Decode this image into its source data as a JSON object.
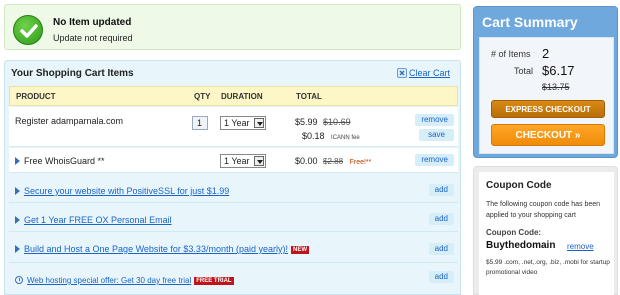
{
  "notice": {
    "title": "No Item updated",
    "subtitle": "Update not required"
  },
  "cart": {
    "heading": "Your Shopping Cart Items",
    "clear_label": "Clear Cart",
    "columns": {
      "product": "PRODUCT",
      "qty": "QTY",
      "duration": "DURATION",
      "total": "TOTAL"
    },
    "items": [
      {
        "name": "Register adamparnala.com",
        "qty": "1",
        "duration": "1 Year",
        "price": "$5.99",
        "old_price": "$10.69",
        "fee": "$0.18",
        "fee_label": "ICANN fee",
        "actions": [
          "remove",
          "save"
        ]
      },
      {
        "name": "Free WhoisGuard **",
        "duration": "1 Year",
        "price": "$0.00",
        "old_price": "$2.88",
        "free_label": "Free!**",
        "actions": [
          "remove"
        ]
      }
    ],
    "offers": [
      {
        "text": "Secure your website with PositiveSSL for just $1.99",
        "action": "add"
      },
      {
        "text": "Get 1 Year FREE OX Personal Email",
        "action": "add"
      },
      {
        "text": "Build and Host a One Page Website for $3.33/month (paid yearly)!",
        "badge": "NEW",
        "action": "add"
      },
      {
        "text": "Web hosting special offer: Get 30 day free trial",
        "badge": "FREE TRIAL",
        "action": "add"
      }
    ]
  },
  "summary": {
    "title": "Cart Summary",
    "items_label": "# of Items",
    "items_count": "2",
    "total_label": "Total",
    "total": "$6.17",
    "old_total": "$13.75",
    "express_label": "EXPRESS CHECKOUT",
    "checkout_label": "CHECKOUT »"
  },
  "coupon": {
    "heading": "Coupon Code",
    "description": "The following coupon code has been applied to your shopping cart",
    "code_label": "Coupon Code:",
    "code": "Buythedomain",
    "remove_label": "remove",
    "note": "$5.99 .com, .net,.org, .biz, .mobi for startup promotional video"
  },
  "colors": {
    "link": "#1a63c9",
    "summary_bg": "#6fa8dc",
    "checkout_orange": "#f5961a",
    "badge_red": "#c0141a"
  }
}
